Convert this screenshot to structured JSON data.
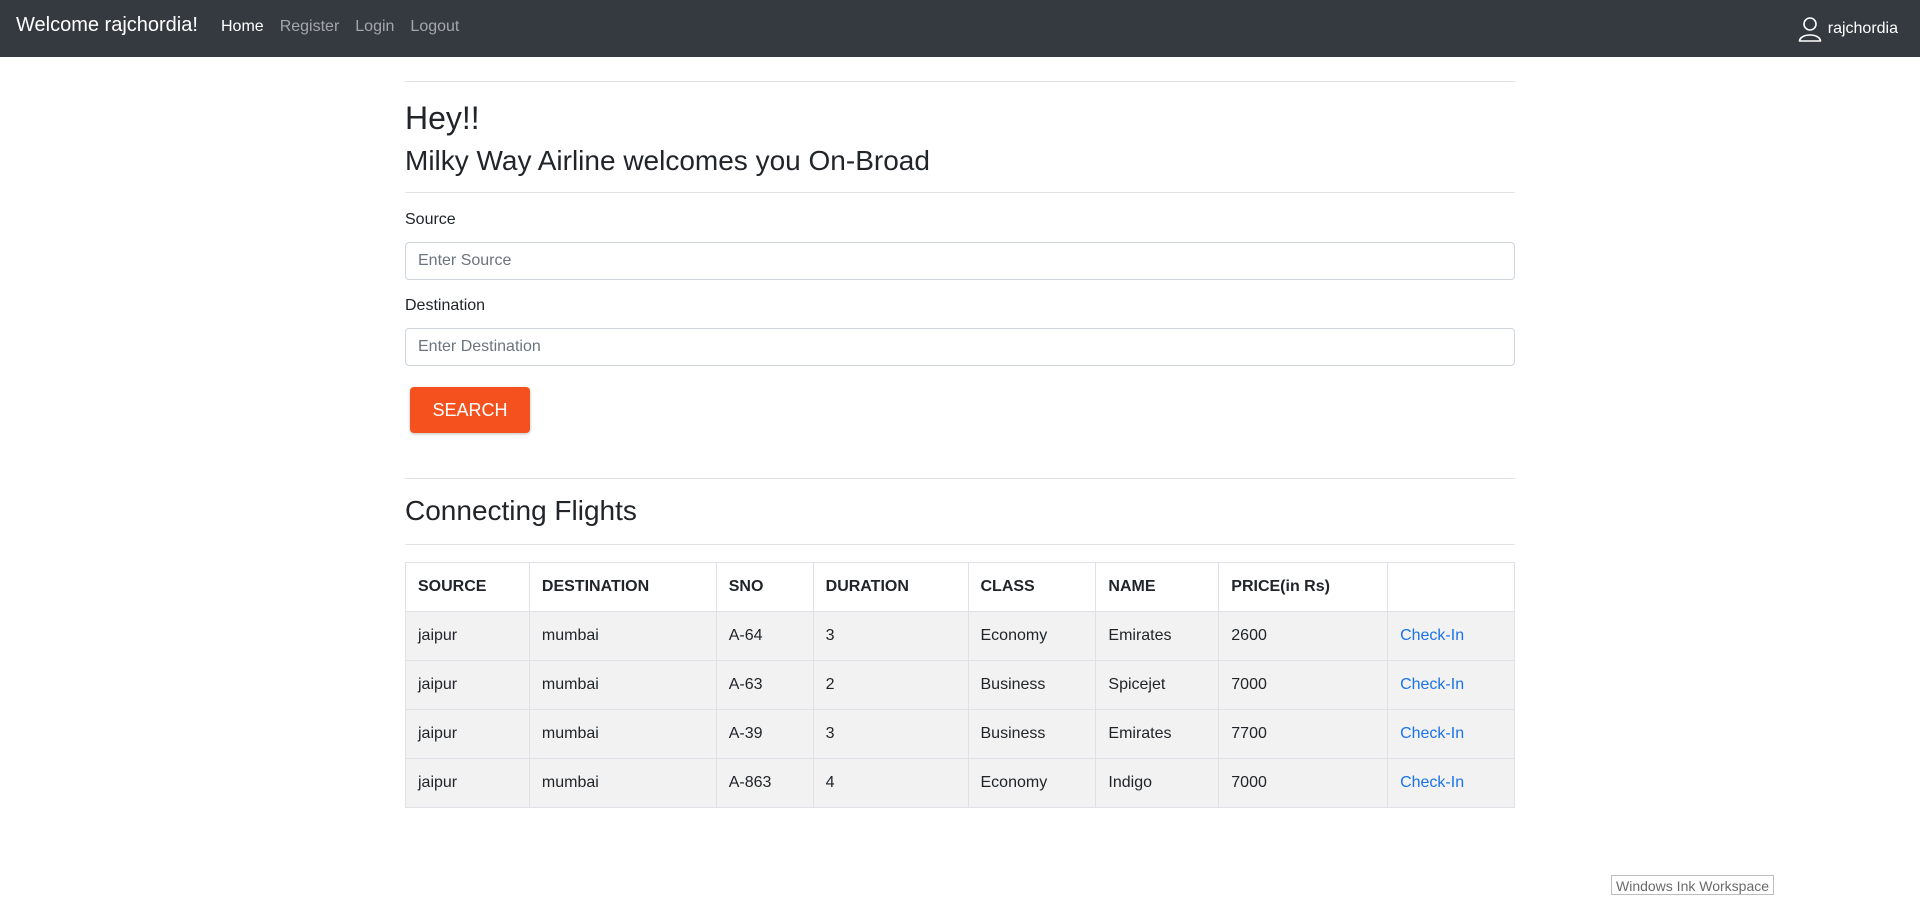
{
  "navbar": {
    "brand": "Welcome rajchordia!",
    "links": [
      {
        "label": "Home",
        "active": true
      },
      {
        "label": "Register",
        "active": false
      },
      {
        "label": "Login",
        "active": false
      },
      {
        "label": "Logout",
        "active": false
      }
    ],
    "user": {
      "icon": "user-icon",
      "name": "rajchordia"
    }
  },
  "hero": {
    "greeting": "Hey!!",
    "subtitle": "Milky Way Airline welcomes you On-Broad"
  },
  "form": {
    "source_label": "Source",
    "source_placeholder": "Enter Source",
    "source_value": "",
    "destination_label": "Destination",
    "destination_placeholder": "Enter Destination",
    "destination_value": "",
    "search_label": "SEARCH"
  },
  "flights": {
    "title": "Connecting Flights",
    "columns": [
      "SOURCE",
      "DESTINATION",
      "SNO",
      "DURATION",
      "CLASS",
      "NAME",
      "PRICE(in Rs)",
      ""
    ],
    "rows": [
      [
        "jaipur",
        "mumbai",
        "A-64",
        "3",
        "Economy",
        "Emirates",
        "2600",
        "Check-In"
      ],
      [
        "jaipur",
        "mumbai",
        "A-63",
        "2",
        "Business",
        "Spicejet",
        "7000",
        "Check-In"
      ],
      [
        "jaipur",
        "mumbai",
        "A-39",
        "3",
        "Business",
        "Emirates",
        "7700",
        "Check-In"
      ],
      [
        "jaipur",
        "mumbai",
        "A-863",
        "4",
        "Economy",
        "Indigo",
        "7000",
        "Check-In"
      ]
    ]
  },
  "taskbar": {
    "ink_workspace": "Windows Ink Workspace"
  },
  "colors": {
    "navbar": "#343a40",
    "search_button": "#f4511e",
    "link": "#1a73e8",
    "row_stripe": "#f2f2f2"
  }
}
